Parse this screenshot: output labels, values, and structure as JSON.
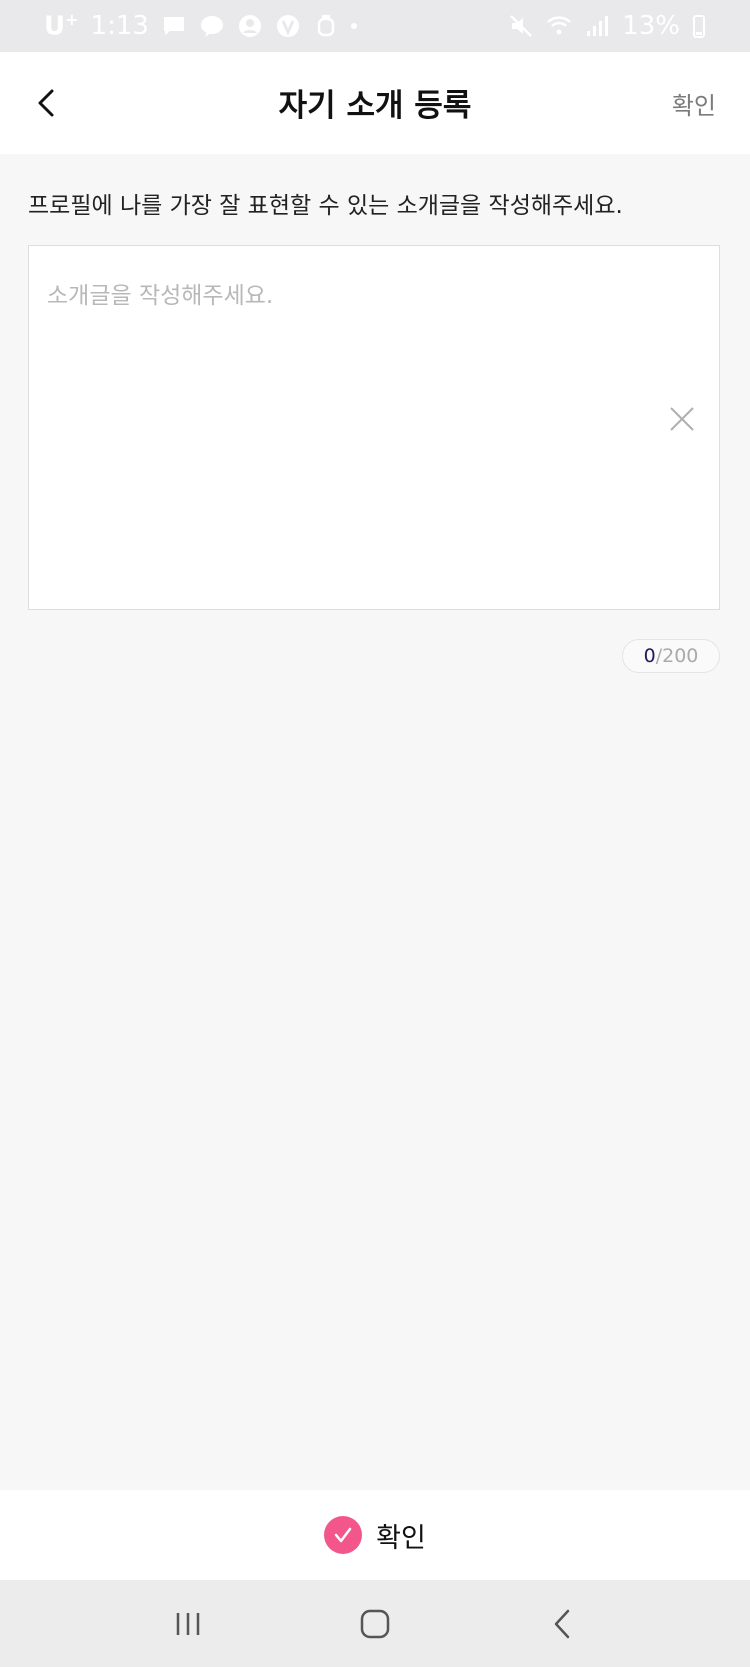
{
  "status_bar": {
    "carrier": "U",
    "carrier_sup": "+",
    "time": "1:13",
    "battery": "13%",
    "icons": [
      "message-icon",
      "talk-icon",
      "account-icon",
      "v-app-icon",
      "watch-icon",
      "mute-icon",
      "wifi-icon",
      "signal-icon",
      "battery-icon"
    ]
  },
  "header": {
    "title": "자기 소개 등록",
    "confirm_label": "확인",
    "back_icon": "chevron-left-icon"
  },
  "form": {
    "instruction": "프로필에 나를 가장 잘 표현할 수 있는 소개글을 작성해주세요.",
    "intro_placeholder": "소개글을 작성해주세요.",
    "intro_value": "",
    "clear_icon": "close-icon",
    "char_count": "0",
    "char_limit": "/200"
  },
  "bottom_bar": {
    "confirm_label": "확인",
    "check_icon": "check-circle-icon",
    "accent_color": "#f2568b"
  },
  "nav_bar": {
    "icons": [
      "recent-apps-icon",
      "home-icon",
      "back-icon"
    ]
  }
}
